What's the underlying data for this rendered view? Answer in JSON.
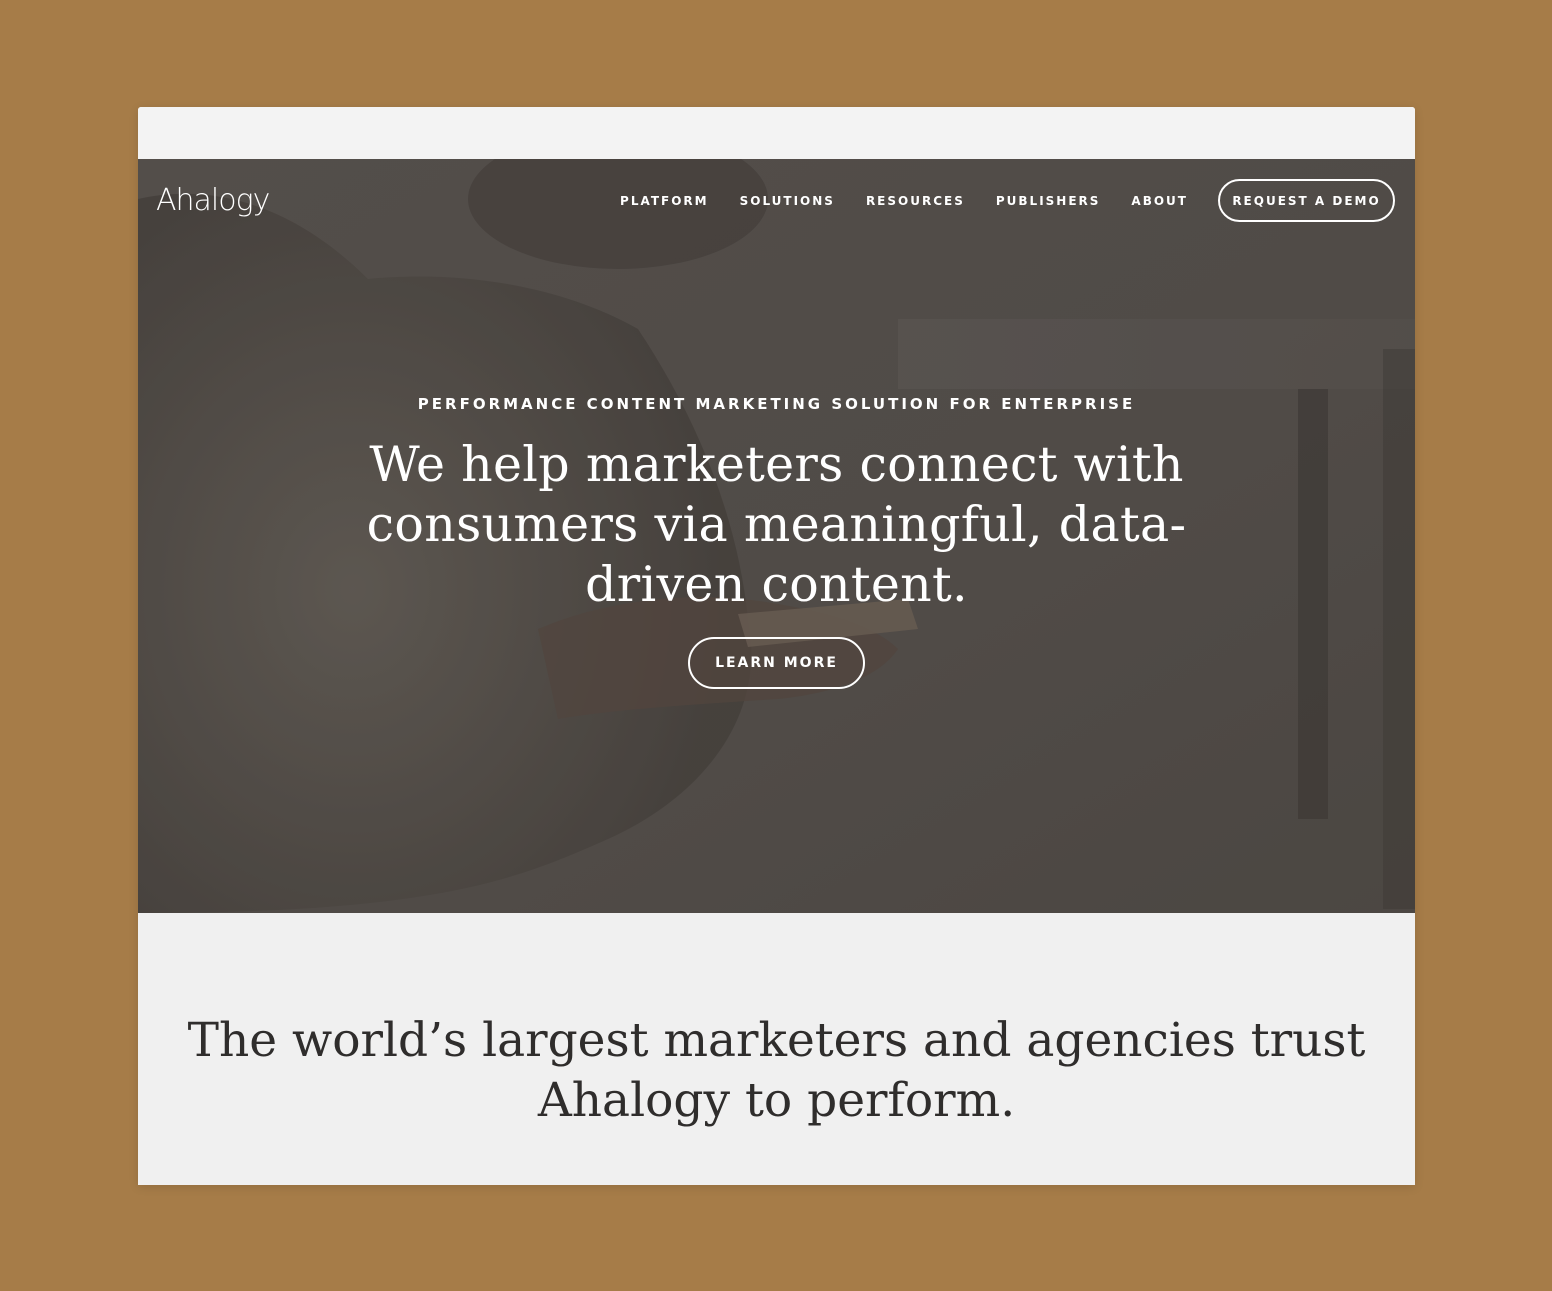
{
  "site": {
    "logo_text": "Ahalogy"
  },
  "nav": {
    "items": [
      {
        "label": "PLATFORM"
      },
      {
        "label": "SOLUTIONS"
      },
      {
        "label": "RESOURCES"
      },
      {
        "label": "PUBLISHERS"
      },
      {
        "label": "ABOUT"
      }
    ],
    "cta_label": "REQUEST A DEMO"
  },
  "hero": {
    "eyebrow": "PERFORMANCE CONTENT MARKETING SOLUTION FOR ENTERPRISE",
    "headline": "We help marketers connect with consumers via meaningful, data-driven content.",
    "button_label": "LEARN MORE"
  },
  "trust": {
    "text": "The world’s largest marketers and agencies trust Ahalogy to perform."
  },
  "colors": {
    "page_background": "#a67c48",
    "hero_overlay": "#5b5652",
    "section_background": "#f0f0f0",
    "text_dark": "#2f2d2c",
    "text_light": "#ffffff"
  }
}
